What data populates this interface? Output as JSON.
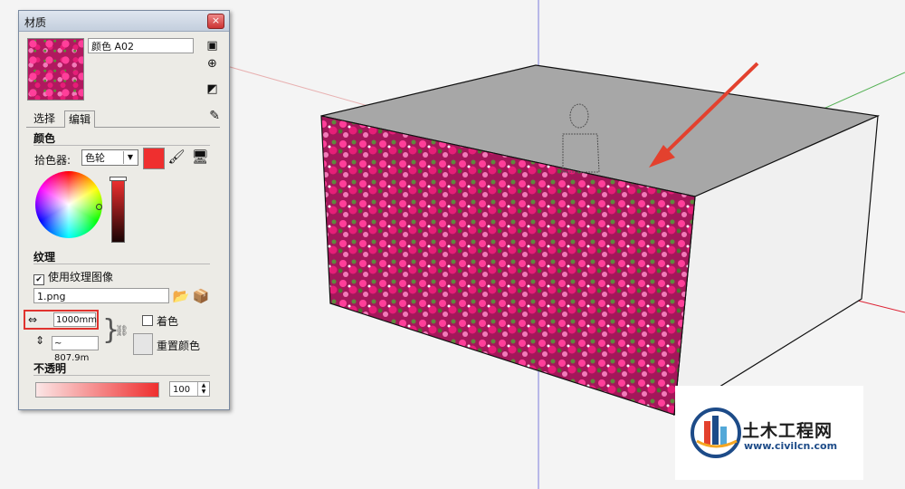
{
  "window": {
    "title": "材质",
    "close": "×"
  },
  "material": {
    "name": "颜色 A02"
  },
  "tabs": {
    "select": "选择",
    "edit": "编辑"
  },
  "color": {
    "section": "颜色",
    "picker_label": "拾色器:",
    "picker_value": "色轮",
    "swatch_color": "#ef2f2f"
  },
  "texture": {
    "section": "纹理",
    "use_texture_label": "使用纹理图像",
    "use_texture_checked": true,
    "file": "1.png",
    "width": "1000mm",
    "height": "~ 807.9m",
    "colorize_label": "着色",
    "reset_label": "重置颜色"
  },
  "opacity": {
    "section": "不透明",
    "value": "100"
  },
  "watermark": {
    "title": "土木工程网",
    "url": "www.civilcn.com"
  },
  "colors": {
    "accent": "#e0332e",
    "texture_pink": "#e61e78",
    "leaf_green": "#5e8a3c"
  }
}
